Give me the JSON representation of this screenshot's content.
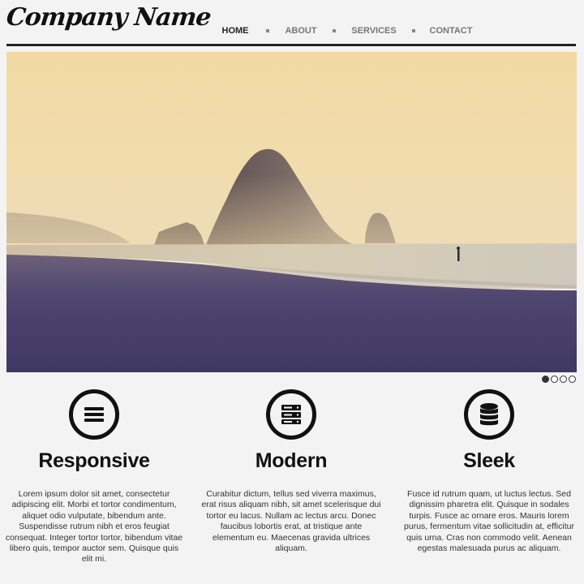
{
  "brand": {
    "name": "Company Name"
  },
  "nav": {
    "items": [
      {
        "label": "HOME",
        "active": true
      },
      {
        "label": "ABOUT",
        "active": false
      },
      {
        "label": "SERVICES",
        "active": false
      },
      {
        "label": "CONTACT",
        "active": false
      }
    ]
  },
  "slider": {
    "slides_count": 4,
    "active_index": 0
  },
  "features": [
    {
      "icon": "menu-icon",
      "title": "Responsive",
      "text": "Lorem ipsum dolor sit amet, consectetur adipiscing elit. Morbi et tortor condimentum, aliquet odio vulputate, bibendum ante. Suspendisse rutrum nibh et eros feugiat consequat. Integer tortor tortor, bibendum vitae libero quis, tempor auctor sem. Quisque quis elit mi."
    },
    {
      "icon": "server-icon",
      "title": "Modern",
      "text": "Curabitur dictum, tellus sed viverra maximus, erat risus aliquam nibh, sit amet scelerisque dui tortor eu lacus. Nullam ac lectus arcu. Donec faucibus lobortis erat, at tristique ante elementum eu. Maecenas gravida ultrices aliquam."
    },
    {
      "icon": "database-icon",
      "title": "Sleek",
      "text": "Fusce id rutrum quam, ut luctus lectus. Sed dignissim pharetra elit. Quisque in sodales turpis. Fusce ac ornare eros. Mauris lorem purus, fermentum vitae sollicitudin at, efficitur quis urna. Cras non commodo velit. Aenean egestas malesuada purus ac aliquam."
    }
  ]
}
